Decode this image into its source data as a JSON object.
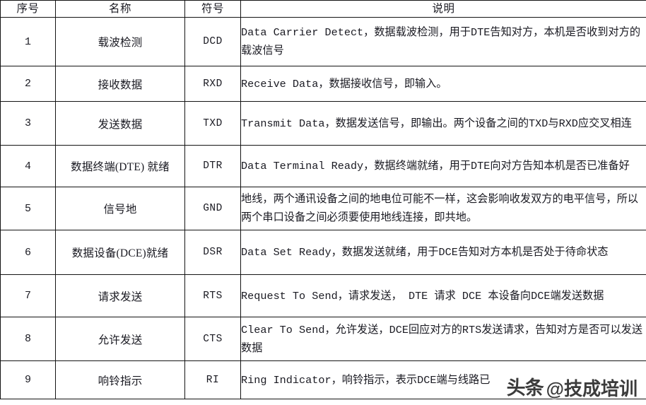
{
  "table": {
    "columns": [
      {
        "key": "seq",
        "label": "序号"
      },
      {
        "key": "name",
        "label": "名称"
      },
      {
        "key": "symbol",
        "label": "符号"
      },
      {
        "key": "desc",
        "label": "说明"
      }
    ],
    "rows": [
      {
        "seq": "1",
        "name": "载波检测",
        "symbol": "DCD",
        "desc": "Data Carrier Detect，数据载波检测，用于DTE告知对方，本机是否收到对方的载波信号"
      },
      {
        "seq": "2",
        "name": "接收数据",
        "symbol": "RXD",
        "desc": "Receive Data，数据接收信号，即输入。"
      },
      {
        "seq": "3",
        "name": "发送数据",
        "symbol": "TXD",
        "desc": "Transmit Data，数据发送信号，即输出。两个设备之间的TXD与RXD应交叉相连"
      },
      {
        "seq": "4",
        "name": "数据终端(DTE)  就绪",
        "symbol": "DTR",
        "desc": "Data Terminal Ready，数据终端就绪，用于DTE向对方告知本机是否已准备好"
      },
      {
        "seq": "5",
        "name": "信号地",
        "symbol": "GND",
        "desc": "地线，两个通讯设备之间的地电位可能不一样，这会影响收发双方的电平信号，所以两个串口设备之间必须要使用地线连接，即共地。"
      },
      {
        "seq": "6",
        "name": "数据设备(DCE)就绪",
        "symbol": "DSR",
        "desc": "Data Set Ready，数据发送就绪，用于DCE告知对方本机是否处于待命状态"
      },
      {
        "seq": "7",
        "name": "请求发送",
        "symbol": "RTS",
        "desc": "Request To Send，请求发送，  DTE  请求  DCE  本设备向DCE端发送数据"
      },
      {
        "seq": "8",
        "name": "允许发送",
        "symbol": "CTS",
        "desc": "Clear To Send，允许发送，DCE回应对方的RTS发送请求，告知对方是否可以发送数据"
      },
      {
        "seq": "9",
        "name": "响铃指示",
        "symbol": "RI",
        "desc": "Ring Indicator，响铃指示，表示DCE端与线路已"
      }
    ]
  },
  "watermark": {
    "logo": "头条",
    "handle": "@技成培训"
  }
}
